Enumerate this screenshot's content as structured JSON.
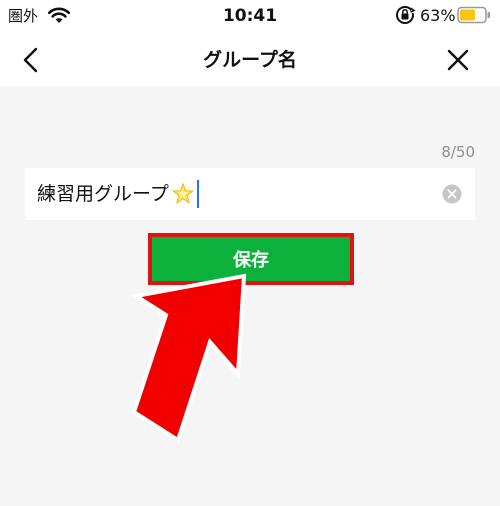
{
  "status_bar": {
    "carrier": "圏外",
    "time": "10:41",
    "battery_percent": "63%",
    "battery_level": 0.63,
    "battery_color": "#f5c518"
  },
  "nav": {
    "title": "グループ名",
    "back_icon": "chevron-left-icon",
    "close_icon": "close-icon"
  },
  "name_field": {
    "value": "練習用グループ",
    "emoji_icon": "glowing-star-icon",
    "char_count": "8/50",
    "clear_icon": "clear-circle-icon"
  },
  "save_button": {
    "label": "保存",
    "color": "#0bb13b",
    "highlight_color": "#e01212"
  },
  "annotation": {
    "icon": "red-arrow-icon",
    "color": "#f20000"
  }
}
